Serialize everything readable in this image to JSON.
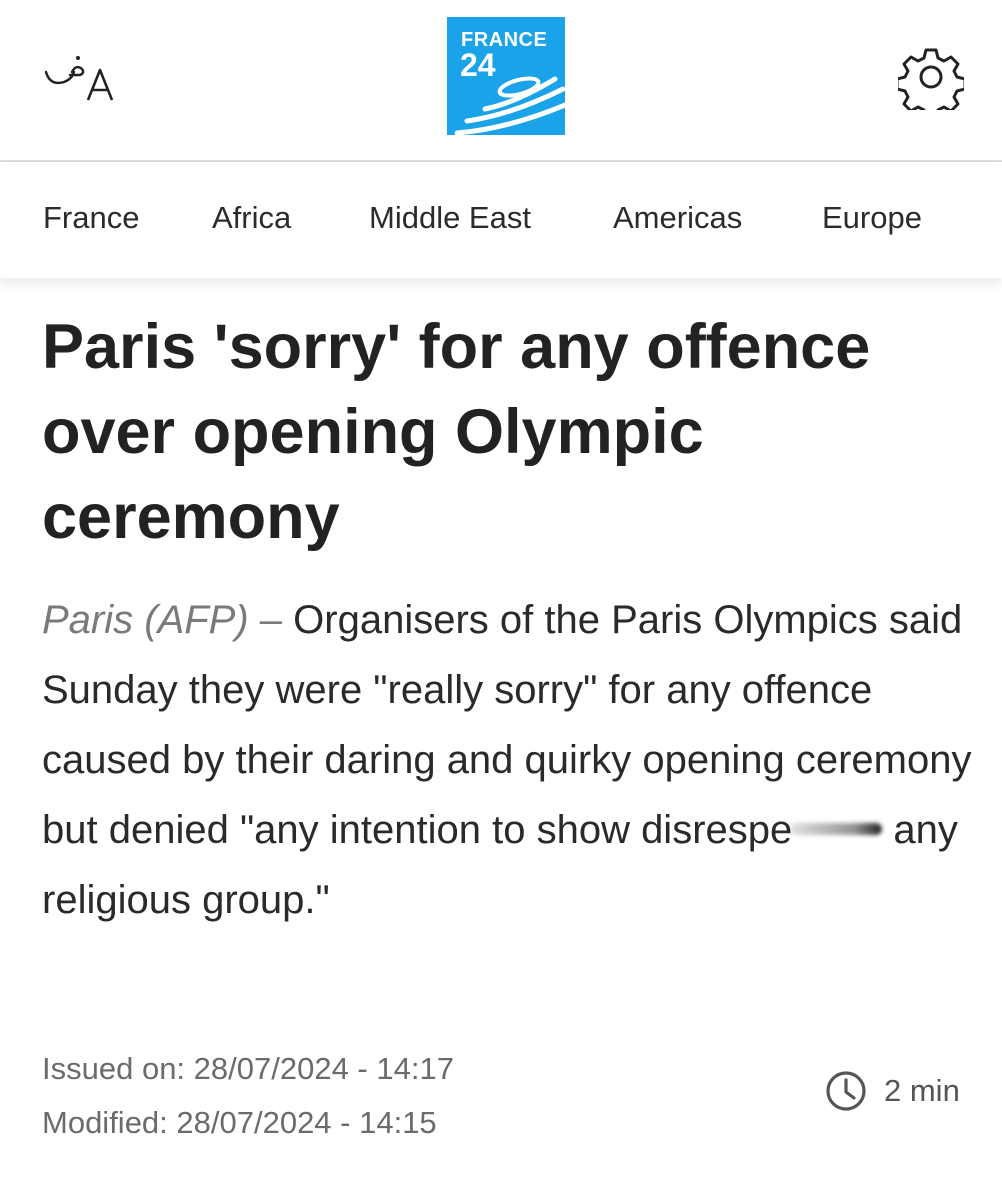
{
  "header": {
    "language_toggle_icon": "language-switch-icon",
    "logo": {
      "line1": "FRANCE",
      "line2": "24",
      "brand_color": "#1aa3e8"
    },
    "settings_icon": "gear-icon"
  },
  "nav": {
    "items": [
      {
        "label": "France"
      },
      {
        "label": "Africa"
      },
      {
        "label": "Middle East"
      },
      {
        "label": "Americas"
      },
      {
        "label": "Europe"
      }
    ]
  },
  "article": {
    "title": "Paris 'sorry' for any offence over opening Olympic ceremony",
    "dateline": "Paris (AFP) –",
    "lead_part1": " Organisers of the Paris Olympics said Sunday they were \"really sorry\" for any offence caused by their daring and quirky opening ceremony but denied \"any intention to show disrespe",
    "lead_part2": " any religious group.\"",
    "issued_on": "Issued on: 28/07/2024 - 14:17",
    "modified": "Modified: 28/07/2024 - 14:15",
    "read_time": "2 min",
    "read_time_icon": "clock-icon"
  }
}
